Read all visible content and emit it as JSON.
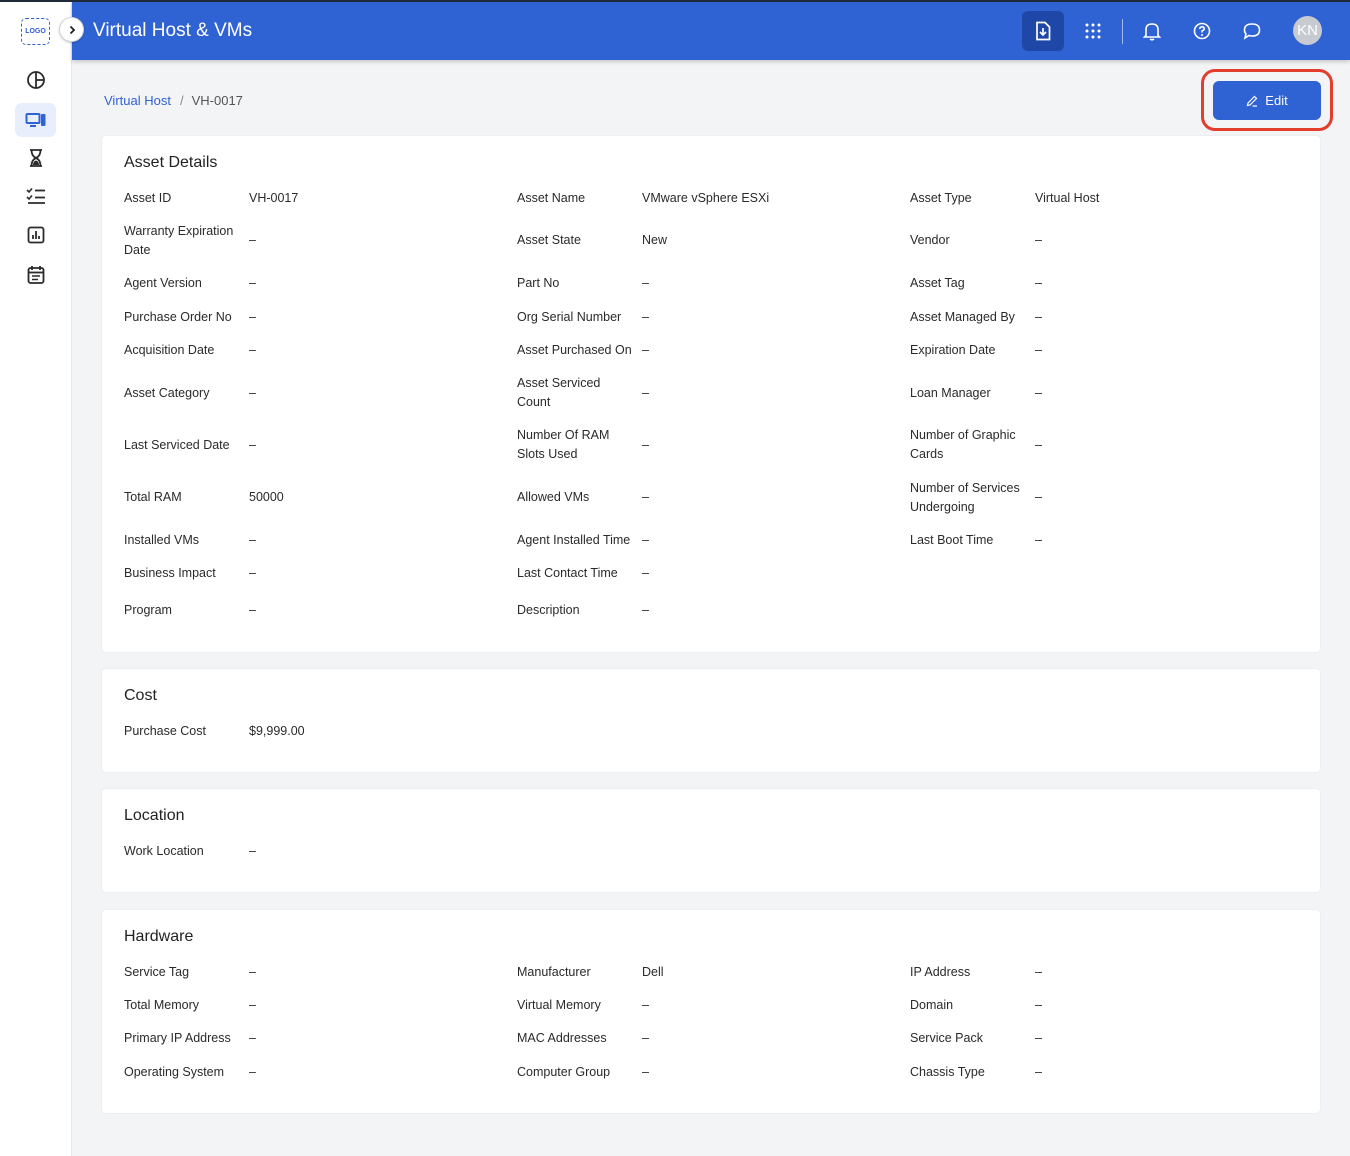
{
  "header": {
    "logo_text": "LOGO",
    "title": "Virtual Host & VMs",
    "avatar_initials": "KN"
  },
  "breadcrumb": {
    "parent": "Virtual Host",
    "separator": "/",
    "current": "VH-0017"
  },
  "actions": {
    "edit_label": "Edit"
  },
  "sidebar_icons": [
    "dashboard-icon",
    "devices-icon",
    "hourglass-icon",
    "checklist-icon",
    "report-icon",
    "calendar-icon"
  ],
  "sections": {
    "asset_details": {
      "title": "Asset Details",
      "fields": [
        {
          "label": "Asset ID",
          "value": "VH-0017"
        },
        {
          "label": "Asset Name",
          "value": "VMware vSphere ESXi"
        },
        {
          "label": "Asset Type",
          "value": "Virtual Host"
        },
        {
          "label": "Warranty Expiration Date",
          "value": "–"
        },
        {
          "label": "Asset State",
          "value": "New"
        },
        {
          "label": "Vendor",
          "value": "–"
        },
        {
          "label": "Agent Version",
          "value": "–"
        },
        {
          "label": "Part No",
          "value": "–"
        },
        {
          "label": "Asset Tag",
          "value": "–"
        },
        {
          "label": "Purchase Order No",
          "value": "–"
        },
        {
          "label": "Org Serial Number",
          "value": "–"
        },
        {
          "label": "Asset Managed By",
          "value": "–"
        },
        {
          "label": "Acquisition Date",
          "value": "–"
        },
        {
          "label": "Asset Purchased On",
          "value": "–"
        },
        {
          "label": "Expiration Date",
          "value": "–"
        },
        {
          "label": "Asset Category",
          "value": "–"
        },
        {
          "label": "Asset Serviced Count",
          "value": "–"
        },
        {
          "label": "Loan Manager",
          "value": "–"
        },
        {
          "label": "Last Serviced Date",
          "value": "–"
        },
        {
          "label": "Number Of RAM Slots Used",
          "value": "–"
        },
        {
          "label": "Number of Graphic Cards",
          "value": "–"
        },
        {
          "label": "Total RAM",
          "value": "50000"
        },
        {
          "label": "Allowed VMs",
          "value": "–"
        },
        {
          "label": "Number of Services Undergoing",
          "value": "–"
        },
        {
          "label": "Installed VMs",
          "value": "–"
        },
        {
          "label": "Agent Installed Time",
          "value": "–"
        },
        {
          "label": "Last Boot Time",
          "value": "–"
        },
        {
          "label": "Business Impact",
          "value": "–"
        },
        {
          "label": "Last Contact Time",
          "value": "–"
        },
        {
          "label": "Program",
          "value": "–"
        },
        {
          "label": "Description",
          "value": "–"
        }
      ]
    },
    "cost": {
      "title": "Cost",
      "fields": [
        {
          "label": "Purchase Cost",
          "value": "$9,999.00"
        }
      ]
    },
    "location": {
      "title": "Location",
      "fields": [
        {
          "label": "Work Location",
          "value": "–"
        }
      ]
    },
    "hardware": {
      "title": "Hardware",
      "fields": [
        {
          "label": "Service Tag",
          "value": "–"
        },
        {
          "label": "Manufacturer",
          "value": "Dell"
        },
        {
          "label": "IP Address",
          "value": "–"
        },
        {
          "label": "Total Memory",
          "value": "–"
        },
        {
          "label": "Virtual Memory",
          "value": "–"
        },
        {
          "label": "Domain",
          "value": "–"
        },
        {
          "label": "Primary IP Address",
          "value": "–"
        },
        {
          "label": "MAC Addresses",
          "value": "–"
        },
        {
          "label": "Service Pack",
          "value": "–"
        },
        {
          "label": "Operating System",
          "value": "–"
        },
        {
          "label": "Computer Group",
          "value": "–"
        },
        {
          "label": "Chassis Type",
          "value": "–"
        }
      ]
    }
  }
}
